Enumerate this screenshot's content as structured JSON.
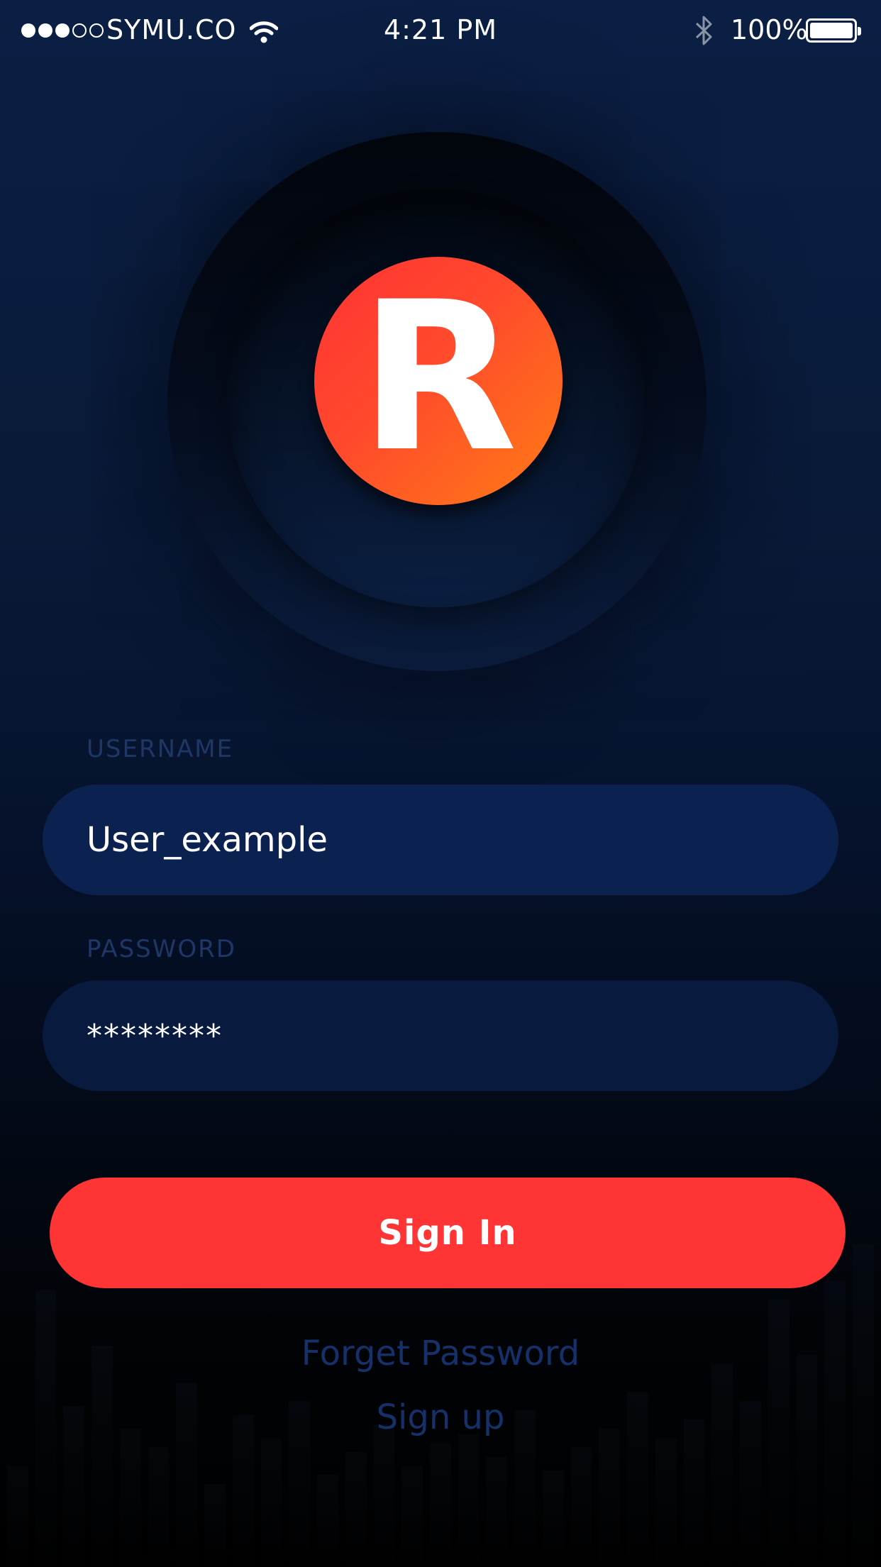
{
  "status_bar": {
    "carrier": "SYMU.CO",
    "time": "4:21 PM",
    "battery_percent": "100%",
    "signal_strength": 3,
    "signal_max": 5,
    "icons": [
      "signal-dots",
      "wifi-icon",
      "bluetooth-icon",
      "battery-icon"
    ]
  },
  "logo": {
    "letter": "R",
    "gradient_colors": [
      "#ff3234",
      "#ff7d15"
    ]
  },
  "form": {
    "username_label": "USERNAME",
    "username_value": "User_example",
    "password_label": "PASSWORD",
    "password_value": "********"
  },
  "actions": {
    "sign_in_label": "Sign In",
    "forget_password_label": "Forget Password",
    "sign_up_label": "Sign up"
  },
  "colors": {
    "accent": "#ff3434",
    "field_bg": "#0b2250",
    "label": "#1e3766",
    "link": "#16306a"
  }
}
